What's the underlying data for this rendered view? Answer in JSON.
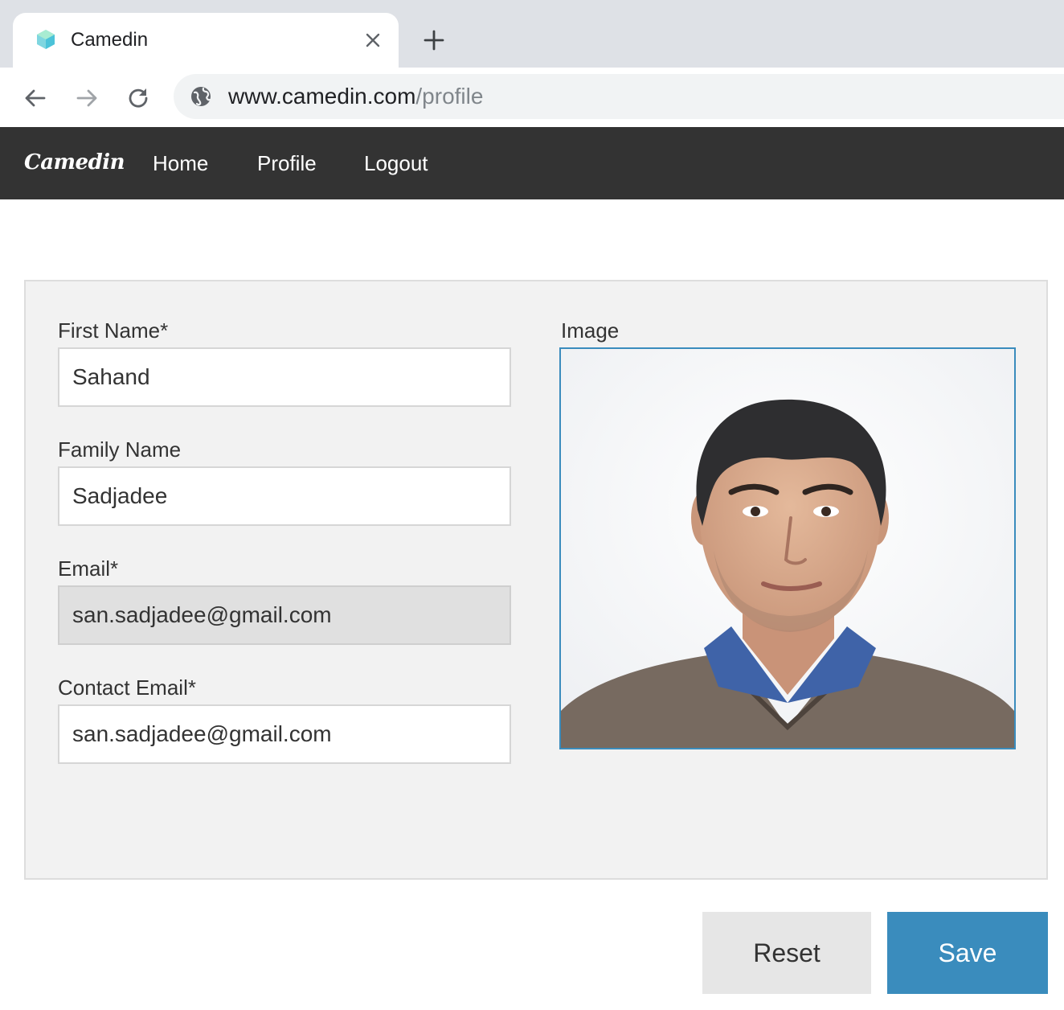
{
  "browser": {
    "tab": {
      "title": "Camedin"
    },
    "address_bar": {
      "domain": "www.camedin.com",
      "path": "/profile"
    },
    "icons": {
      "favicon": "hexagon-favicon-icon",
      "close": "close-icon",
      "new_tab": "plus-icon",
      "back": "arrow-left-icon",
      "forward": "arrow-right-icon",
      "reload": "reload-icon",
      "site_info": "globe-icon"
    }
  },
  "navbar": {
    "brand": "Camedin",
    "links": [
      {
        "label": "Home"
      },
      {
        "label": "Profile"
      },
      {
        "label": "Logout"
      }
    ]
  },
  "form": {
    "first_name": {
      "label": "First Name*",
      "value": "Sahand"
    },
    "family_name": {
      "label": "Family Name",
      "value": "Sadjadee"
    },
    "email": {
      "label": "Email*",
      "value": "san.sadjadee@gmail.com",
      "disabled": true
    },
    "contact_email": {
      "label": "Contact Email*",
      "value": "san.sadjadee@gmail.com"
    },
    "image": {
      "label": "Image"
    }
  },
  "actions": {
    "reset_label": "Reset",
    "save_label": "Save"
  },
  "colors": {
    "navbar_bg": "#333333",
    "accent": "#3a8cbd",
    "panel_bg": "#f2f2f2",
    "disabled_input_bg": "#e0e0e0"
  }
}
